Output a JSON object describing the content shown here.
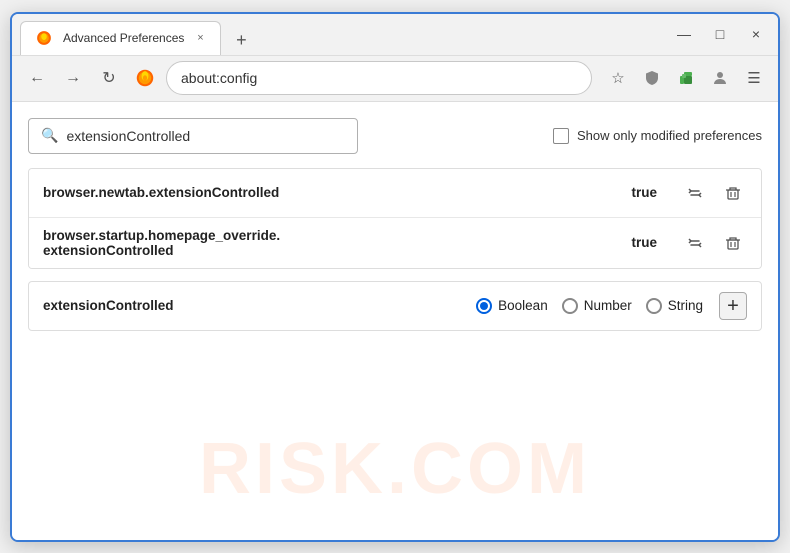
{
  "window": {
    "title": "Advanced Preferences",
    "tab_close": "×",
    "new_tab": "+",
    "minimize": "—",
    "maximize": "□",
    "close": "×"
  },
  "nav": {
    "back": "←",
    "forward": "→",
    "refresh": "↻",
    "browser_name": "Firefox",
    "address": "about:config",
    "bookmark": "☆",
    "shield": "🛡",
    "extension": "🧩",
    "profile": "👤",
    "menu": "☰"
  },
  "search": {
    "value": "extensionControlled",
    "placeholder": "extensionControlled",
    "show_modified_label": "Show only modified preferences"
  },
  "results": [
    {
      "name": "browser.newtab.extensionControlled",
      "value": "true"
    },
    {
      "name_line1": "browser.startup.homepage_override.",
      "name_line2": "extensionControlled",
      "value": "true"
    }
  ],
  "add_row": {
    "name": "extensionControlled",
    "types": [
      "Boolean",
      "Number",
      "String"
    ],
    "selected_type": "Boolean",
    "add_btn": "+"
  },
  "watermark": "RISK.COM"
}
